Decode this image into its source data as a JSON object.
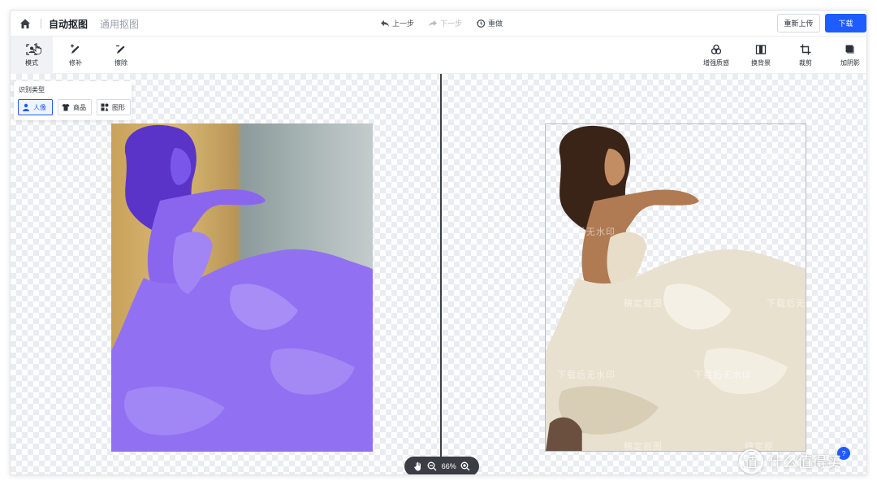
{
  "header": {
    "tabs": [
      {
        "label": "自动抠图",
        "active": true
      },
      {
        "label": "通用抠图",
        "active": false
      }
    ],
    "history": {
      "undo_label": "上一步",
      "redo_label": "下一步",
      "reset_label": "重做"
    },
    "reupload_label": "重新上传",
    "download_label": "下载"
  },
  "toolbar": {
    "left_tools": [
      {
        "label": "模式",
        "icon": "portrait-select-icon",
        "active": true
      },
      {
        "label": "修补",
        "icon": "brush-plus-icon",
        "active": false
      },
      {
        "label": "擦除",
        "icon": "brush-minus-icon",
        "active": false
      }
    ],
    "right_tools": [
      {
        "label": "增强质感",
        "icon": "enhance-icon"
      },
      {
        "label": "换背景",
        "icon": "background-icon"
      },
      {
        "label": "裁剪",
        "icon": "crop-icon"
      },
      {
        "label": "加阴影",
        "icon": "shadow-icon"
      }
    ]
  },
  "type_panel": {
    "title": "识别类型",
    "options": [
      {
        "label": "人像",
        "icon": "person-icon",
        "selected": true
      },
      {
        "label": "商品",
        "icon": "shirt-icon",
        "selected": false
      },
      {
        "label": "图形",
        "icon": "shapes-icon",
        "selected": false
      }
    ]
  },
  "preview": {
    "watermarks": [
      "稿定抠图",
      "下载后无水印",
      "稿定抠图",
      "下载后无水印",
      "稿定抠图",
      "下载后无水印"
    ],
    "watermark_bottom": "稿定抠图",
    "watermark_bottom_right": "稿定抠"
  },
  "zoom": {
    "value": "66%"
  },
  "help_label": "?",
  "site_watermark": {
    "logo": "值",
    "text": "什么值得买"
  },
  "colors": {
    "accent": "#1f5cff",
    "mask": "#7a55f0",
    "divider": "#3c4048"
  }
}
